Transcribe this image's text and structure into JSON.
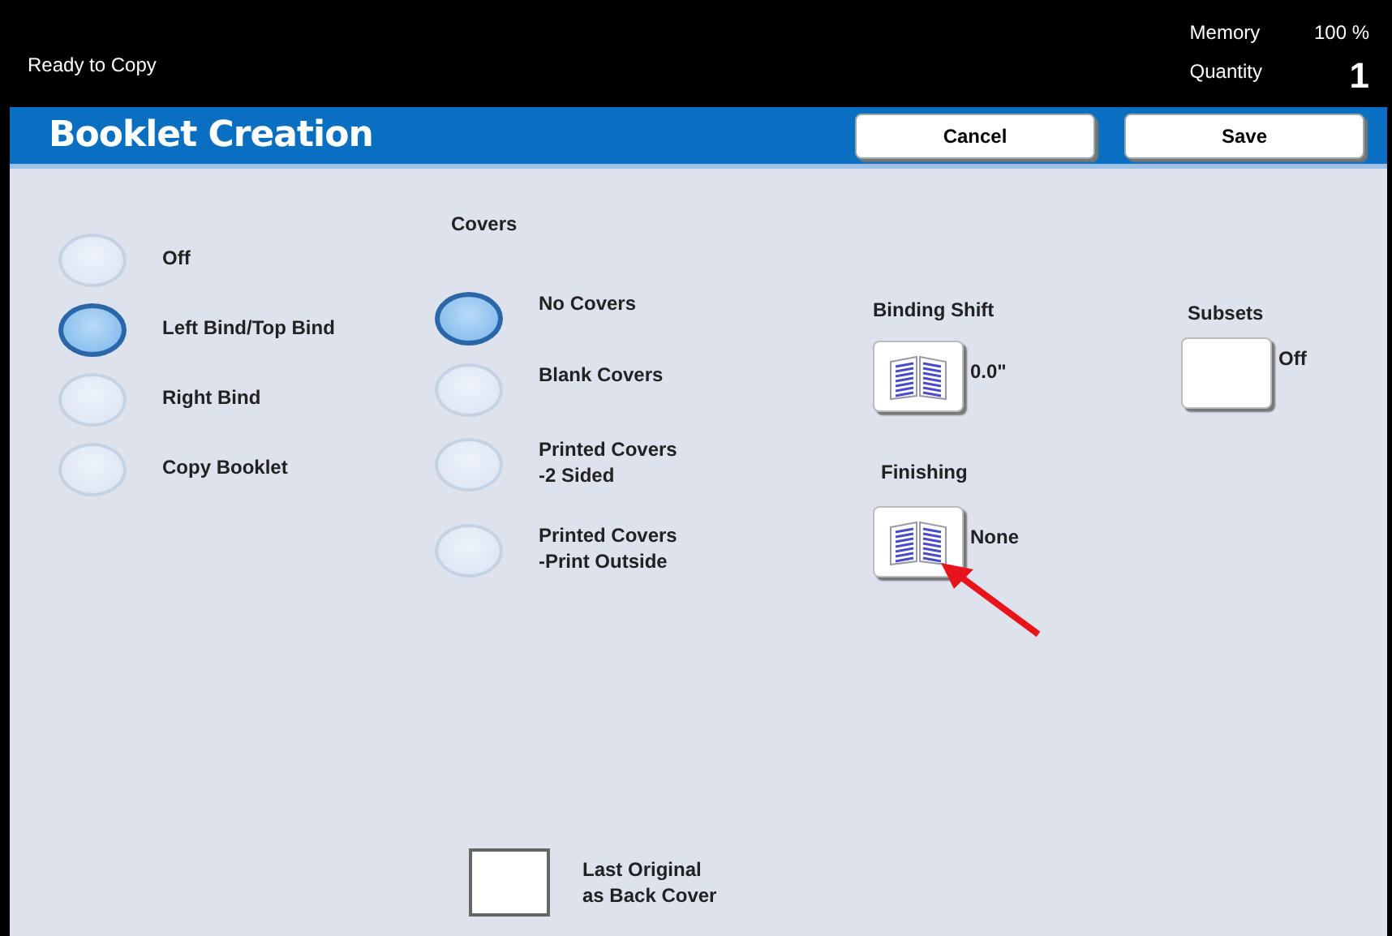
{
  "status_bar": {
    "message": "Ready to Copy",
    "memory_label": "Memory",
    "memory_value": "100 %",
    "quantity_label": "Quantity",
    "quantity_value": "1"
  },
  "header": {
    "title": "Booklet Creation",
    "buttons": [
      "Cancel",
      "Save"
    ]
  },
  "binding": {
    "options": [
      {
        "label": "Off",
        "selected": false
      },
      {
        "label": "Left Bind/Top Bind",
        "selected": true
      },
      {
        "label": "Right Bind",
        "selected": false
      },
      {
        "label": "Copy Booklet",
        "selected": false
      }
    ]
  },
  "covers": {
    "heading": "Covers",
    "options": [
      {
        "lines": [
          "No Covers"
        ],
        "selected": true
      },
      {
        "lines": [
          "Blank Covers"
        ],
        "selected": false
      },
      {
        "lines": [
          "Printed Covers",
          "-2 Sided"
        ],
        "selected": false
      },
      {
        "lines": [
          "Printed Covers",
          "-Print Outside"
        ],
        "selected": false
      }
    ]
  },
  "binding_shift": {
    "heading": "Binding Shift",
    "value": "0.0\""
  },
  "finishing": {
    "heading": "Finishing",
    "value": "None"
  },
  "subsets": {
    "heading": "Subsets",
    "value": "Off"
  },
  "last_original": {
    "lines": [
      "Last Original",
      "as Back Cover"
    ],
    "checked": false
  }
}
